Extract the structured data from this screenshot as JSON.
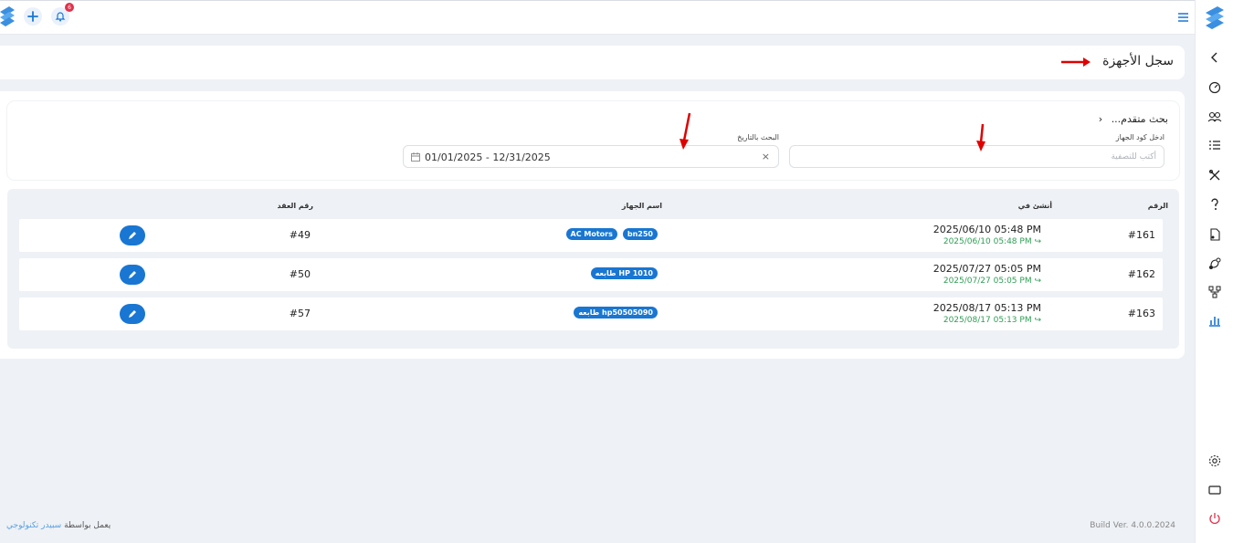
{
  "header": {
    "notification_count": "6"
  },
  "page": {
    "title": "سجل الأجهزة"
  },
  "search": {
    "title": "بحث متقدم...",
    "device_code_label": "ادخل كود الجهاز",
    "device_code_placeholder": "أكتب للتصفية",
    "date_label": "البحث بالتاريخ",
    "date_range": "01/01/2025 - 12/31/2025"
  },
  "table": {
    "headers": {
      "number": "الرقم",
      "created_at": "أنشئ في",
      "device_name": "اسم الجهاز",
      "contract_number": "رقم العقد"
    },
    "rows": [
      {
        "number": "#161",
        "created": "2025/06/10 05:48 PM",
        "updated": "2025/06/10 05:48 PM ↪",
        "tags": [
          "bn250",
          "AC Motors"
        ],
        "contract": "#49"
      },
      {
        "number": "#162",
        "created": "2025/07/27 05:05 PM",
        "updated": "2025/07/27 05:05 PM ↪",
        "tags": [
          "طابعه HP 1010"
        ],
        "contract": "#50"
      },
      {
        "number": "#163",
        "created": "2025/08/17 05:13 PM",
        "updated": "2025/08/17 05:13 PM ↪",
        "tags": [
          "طابعه hp50505090"
        ],
        "contract": "#57"
      }
    ]
  },
  "footer": {
    "build": "Build Ver. 4.0.0.2024",
    "powered_prefix": "يعمل بواسطة",
    "powered_brand": "سبيدر تكنولوجي"
  },
  "colors": {
    "accent": "#1976d2",
    "success": "#2e9e54",
    "danger": "#e0324b",
    "annotation": "#e00000"
  },
  "icons": [
    "logo-icon",
    "plus-icon",
    "bell-icon",
    "menu-icon",
    "chevron-left-icon",
    "dashboard-icon",
    "users-icon",
    "list-icon",
    "tools-icon",
    "question-icon",
    "document-icon",
    "workflow-icon",
    "hierarchy-icon",
    "chart-icon",
    "gear-icon",
    "screen-icon",
    "power-icon",
    "calendar-icon",
    "pencil-icon"
  ]
}
